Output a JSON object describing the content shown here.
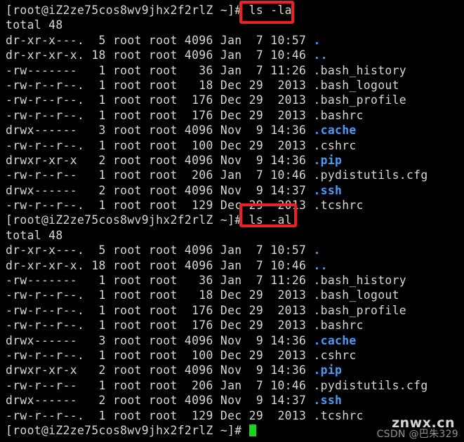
{
  "terminal": {
    "title": "root terminal session",
    "background_color": "#000000",
    "foreground_color": "#d8d8d0",
    "dir_color": "#4d9bf5",
    "cursor_color": "#18d618",
    "annotation_color": "#ef2020",
    "prompt": "[root@iZ2ze75cos8wv9jhx2f2rlZ ~]#",
    "commands": {
      "first": "ls -la",
      "second": "ls -al"
    },
    "total_line": "total 48",
    "listing": [
      {
        "perms": "dr-xr-x---.",
        "links": "5",
        "owner": "root",
        "group": "root",
        "size": "4096",
        "month": "Jan",
        "day": "7",
        "time": "10:57",
        "name": ".",
        "type": "dir"
      },
      {
        "perms": "dr-xr-xr-x.",
        "links": "18",
        "owner": "root",
        "group": "root",
        "size": "4096",
        "month": "Jan",
        "day": "7",
        "time": "10:46",
        "name": "..",
        "type": "dir"
      },
      {
        "perms": "-rw-------",
        "links": "1",
        "owner": "root",
        "group": "root",
        "size": "36",
        "month": "Jan",
        "day": "7",
        "time": "11:26",
        "name": ".bash_history",
        "type": "file"
      },
      {
        "perms": "-rw-r--r--.",
        "links": "1",
        "owner": "root",
        "group": "root",
        "size": "18",
        "month": "Dec",
        "day": "29",
        "time": "2013",
        "name": ".bash_logout",
        "type": "file"
      },
      {
        "perms": "-rw-r--r--.",
        "links": "1",
        "owner": "root",
        "group": "root",
        "size": "176",
        "month": "Dec",
        "day": "29",
        "time": "2013",
        "name": ".bash_profile",
        "type": "file"
      },
      {
        "perms": "-rw-r--r--.",
        "links": "1",
        "owner": "root",
        "group": "root",
        "size": "176",
        "month": "Dec",
        "day": "29",
        "time": "2013",
        "name": ".bashrc",
        "type": "file"
      },
      {
        "perms": "drwx------",
        "links": "3",
        "owner": "root",
        "group": "root",
        "size": "4096",
        "month": "Nov",
        "day": "9",
        "time": "14:36",
        "name": ".cache",
        "type": "dir"
      },
      {
        "perms": "-rw-r--r--.",
        "links": "1",
        "owner": "root",
        "group": "root",
        "size": "100",
        "month": "Dec",
        "day": "29",
        "time": "2013",
        "name": ".cshrc",
        "type": "file"
      },
      {
        "perms": "drwxr-xr-x",
        "links": "2",
        "owner": "root",
        "group": "root",
        "size": "4096",
        "month": "Nov",
        "day": "9",
        "time": "14:36",
        "name": ".pip",
        "type": "dir"
      },
      {
        "perms": "-rw-r--r--",
        "links": "1",
        "owner": "root",
        "group": "root",
        "size": "206",
        "month": "Jan",
        "day": "7",
        "time": "10:46",
        "name": ".pydistutils.cfg",
        "type": "file"
      },
      {
        "perms": "drwx------",
        "links": "2",
        "owner": "root",
        "group": "root",
        "size": "4096",
        "month": "Nov",
        "day": "9",
        "time": "14:37",
        "name": ".ssh",
        "type": "dir"
      },
      {
        "perms": "-rw-r--r--.",
        "links": "1",
        "owner": "root",
        "group": "root",
        "size": "129",
        "month": "Dec",
        "day": "29",
        "time": "2013",
        "name": ".tcshrc",
        "type": "file"
      }
    ]
  },
  "watermark": {
    "main": "znwx.cn",
    "sub": "CSDN @巴朱329"
  }
}
